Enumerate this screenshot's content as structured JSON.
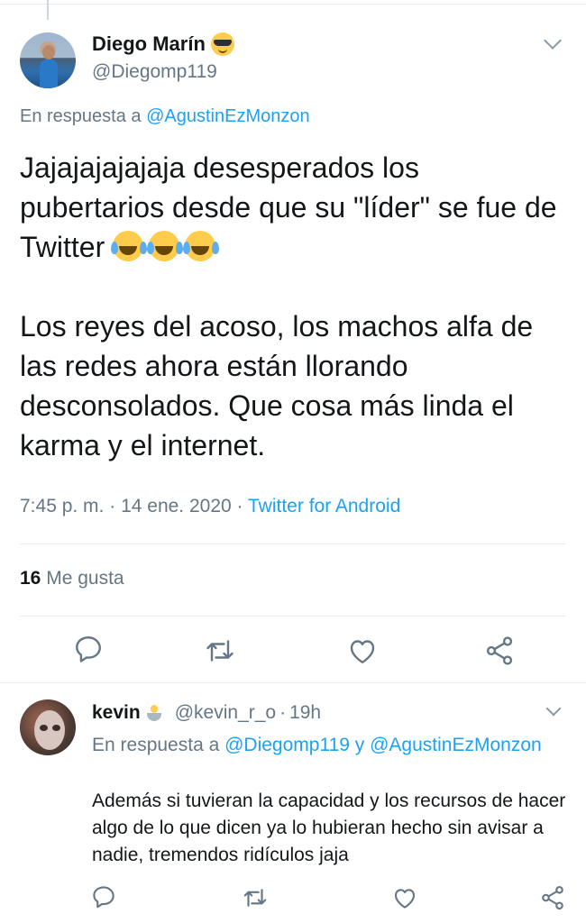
{
  "tweet": {
    "author_name": "Diego Marín",
    "author_emoji": "smiling-face-with-sunglasses",
    "author_handle": "@Diegomp119",
    "reply_prefix": "En respuesta a ",
    "reply_to": "@AgustinEzMonzon",
    "text_p1_line": "Jajajajajajaja desesperados los pubertarios desde que su \"líder\" se fue de Twitter ",
    "text_p1_emojis": [
      "face-with-tears-of-joy",
      "face-with-tears-of-joy",
      "face-with-tears-of-joy"
    ],
    "text_p2": "Los reyes del acoso, los machos alfa de las redes ahora están llorando desconsolados. Que cosa más linda el karma y el internet.",
    "time": "7:45 p. m.",
    "date": "14 ene. 2020",
    "separator": "·",
    "source": "Twitter for Android",
    "likes_count": "16",
    "likes_label": "Me gusta"
  },
  "reply": {
    "author_name": "kevin",
    "author_emoji": "person-in-lotus-position",
    "author_handle": "@kevin_r_o",
    "separator": "·",
    "age": "19h",
    "reply_prefix": "En respuesta a ",
    "reply_to_1": "@Diegomp119",
    "reply_conj": " y ",
    "reply_to_2": "@AgustinEzMonzon",
    "text": "Además si tuvieran la capacidad y los recursos de hacer algo de lo que dicen ya lo hubieran hecho sin avisar a nadie, tremendos ridículos jaja"
  },
  "icons": {
    "reply": "reply-icon",
    "retweet": "retweet-icon",
    "like": "like-icon",
    "share": "share-icon",
    "more": "chevron-down-icon"
  },
  "colors": {
    "accent": "#1da1f2",
    "secondary_text": "#657786",
    "primary_text": "#14171a",
    "icon": "#657786",
    "divider": "#e6ecf0"
  }
}
